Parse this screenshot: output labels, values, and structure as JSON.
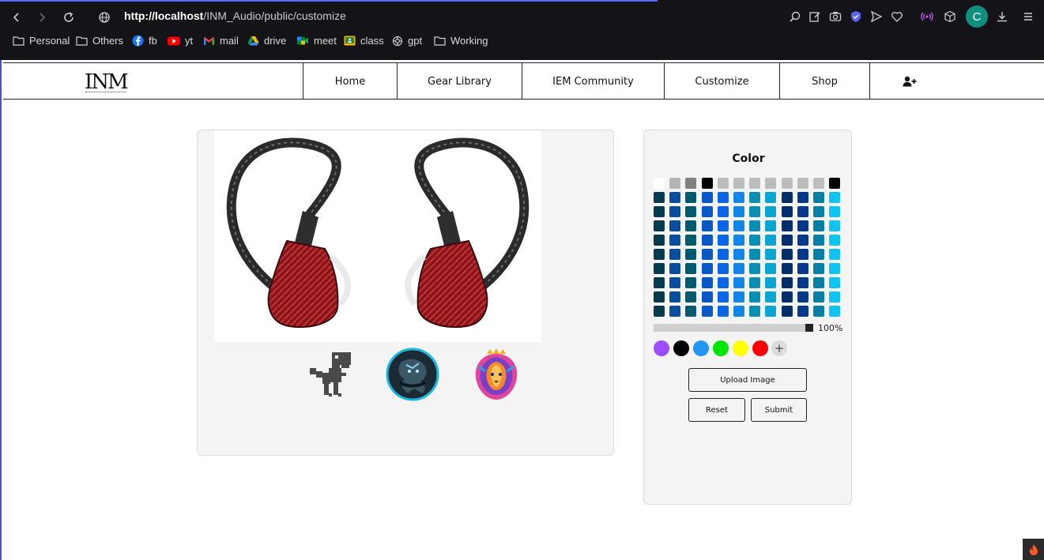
{
  "browser": {
    "url_host": "http://localhost",
    "url_path": "/INM_Audio/public/customize",
    "profile_initial": "C",
    "bookmarks": [
      {
        "label": "Personal",
        "icon": "folder-icon"
      },
      {
        "label": "Others",
        "icon": "folder-icon"
      },
      {
        "label": "fb",
        "icon": "facebook-icon"
      },
      {
        "label": "yt",
        "icon": "youtube-icon"
      },
      {
        "label": "mail",
        "icon": "gmail-icon"
      },
      {
        "label": "drive",
        "icon": "drive-icon"
      },
      {
        "label": "meet",
        "icon": "meet-icon"
      },
      {
        "label": "class",
        "icon": "classroom-icon"
      },
      {
        "label": "gpt",
        "icon": "chatgpt-icon"
      },
      {
        "label": "Working",
        "icon": "folder-icon"
      }
    ]
  },
  "site": {
    "logo": "INM",
    "nav": [
      {
        "label": "Home"
      },
      {
        "label": "Gear Library"
      },
      {
        "label": "IEM Community"
      },
      {
        "label": "Customize"
      },
      {
        "label": "Shop"
      }
    ],
    "user_icon": "add-user-icon"
  },
  "preview": {
    "product_image": "red-iem-earphones",
    "stickers": [
      "dino-sticker",
      "dragon-sticker",
      "lion-sticker"
    ]
  },
  "color_panel": {
    "title": "Color",
    "alpha_label": "100%",
    "alpha_value": 1.0,
    "grays": [
      "#ffffff",
      "#b5b5b5",
      "#808080",
      "#000000",
      "#bdbdbd",
      "#bdbdbd",
      "#bdbdbd",
      "#bdbdbd",
      "#bdbdbd",
      "#bdbdbd",
      "#bdbdbd",
      "#000000"
    ],
    "column_colors": [
      "#063a4f",
      "#0a4d9c",
      "#045b6e",
      "#0757c7",
      "#0a66e6",
      "#1186e8",
      "#0a8fb3",
      "#0aa6d3",
      "#062d6b",
      "#06388c",
      "#0a7fa6",
      "#0ec4f0"
    ],
    "color_rows": 9,
    "presets": [
      "#9b4dff",
      "#000000",
      "#2196f3",
      "#00e600",
      "#ffff00",
      "#ff0000"
    ],
    "upload_label": "Upload Image",
    "reset_label": "Reset",
    "submit_label": "Submit"
  }
}
